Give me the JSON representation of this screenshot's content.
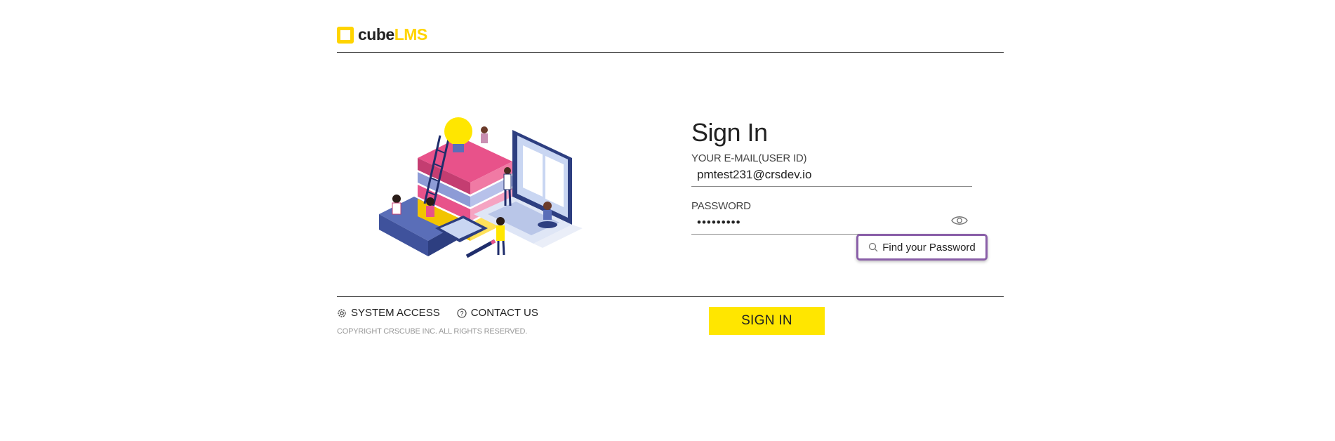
{
  "brand": {
    "logo_cube": "cube",
    "logo_lms": "LMS",
    "accent_color": "#ffe600",
    "highlight_color": "#8a5fa8"
  },
  "form": {
    "title": "Sign In",
    "email_label": "YOUR E-MAIL(USER ID)",
    "email_value": "pmtest231@crsdev.io",
    "password_label": "PASSWORD",
    "password_value": "•••••••••",
    "show_password_icon": "eye-icon",
    "find_password_label": "Find your Password",
    "find_password_icon": "search-icon"
  },
  "footer": {
    "system_access_label": "SYSTEM ACCESS",
    "system_access_icon": "gear-icon",
    "contact_label": "CONTACT US",
    "contact_icon": "question-circle-icon",
    "copyright": "COPYRIGHT CRSCUBE INC. ALL RIGHTS RESERVED.",
    "signin_label": "SIGN IN"
  }
}
